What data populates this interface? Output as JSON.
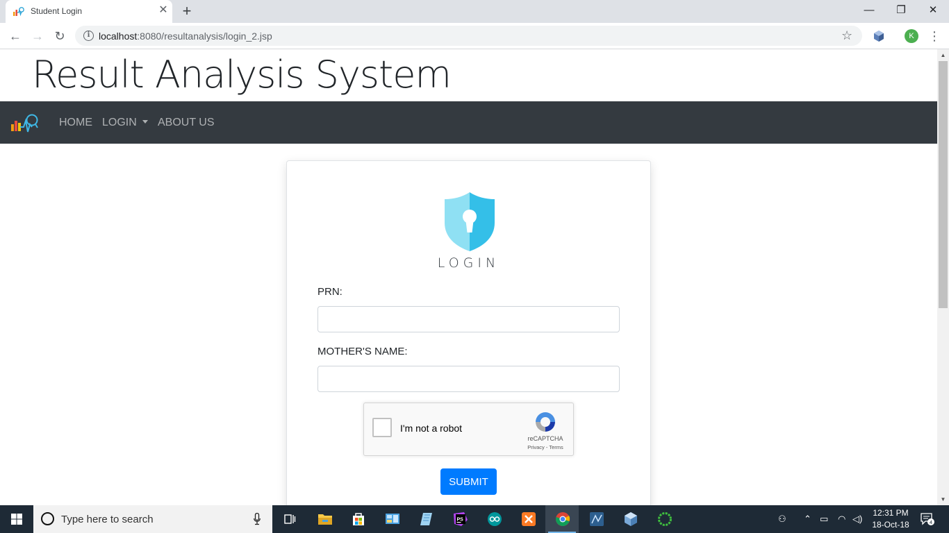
{
  "browser": {
    "tab_title": "Student Login",
    "url_host": "localhost",
    "url_rest": ":8080/resultanalysis/login_2.jsp",
    "profile_initial": "K"
  },
  "site": {
    "title": "Result Analysis System",
    "nav": {
      "home": "HOME",
      "login": "LOGIN",
      "about": "ABOUT US"
    }
  },
  "login_card": {
    "heading": "LOGIN",
    "prn_label": "PRN:",
    "prn_value": "",
    "mother_label": "MOTHER'S NAME:",
    "mother_value": "",
    "recaptcha": {
      "label": "I'm not a robot",
      "brand": "reCAPTCHA",
      "terms": "Privacy - Terms",
      "checked": false
    },
    "submit_label": "SUBMIT"
  },
  "taskbar": {
    "search_placeholder": "Type here to search",
    "time": "12:31 PM",
    "date": "18-Oct-18",
    "notification_count": "4"
  },
  "colors": {
    "navbar_bg": "#343a40",
    "primary": "#007bff",
    "taskbar_bg": "#1e2a36"
  }
}
